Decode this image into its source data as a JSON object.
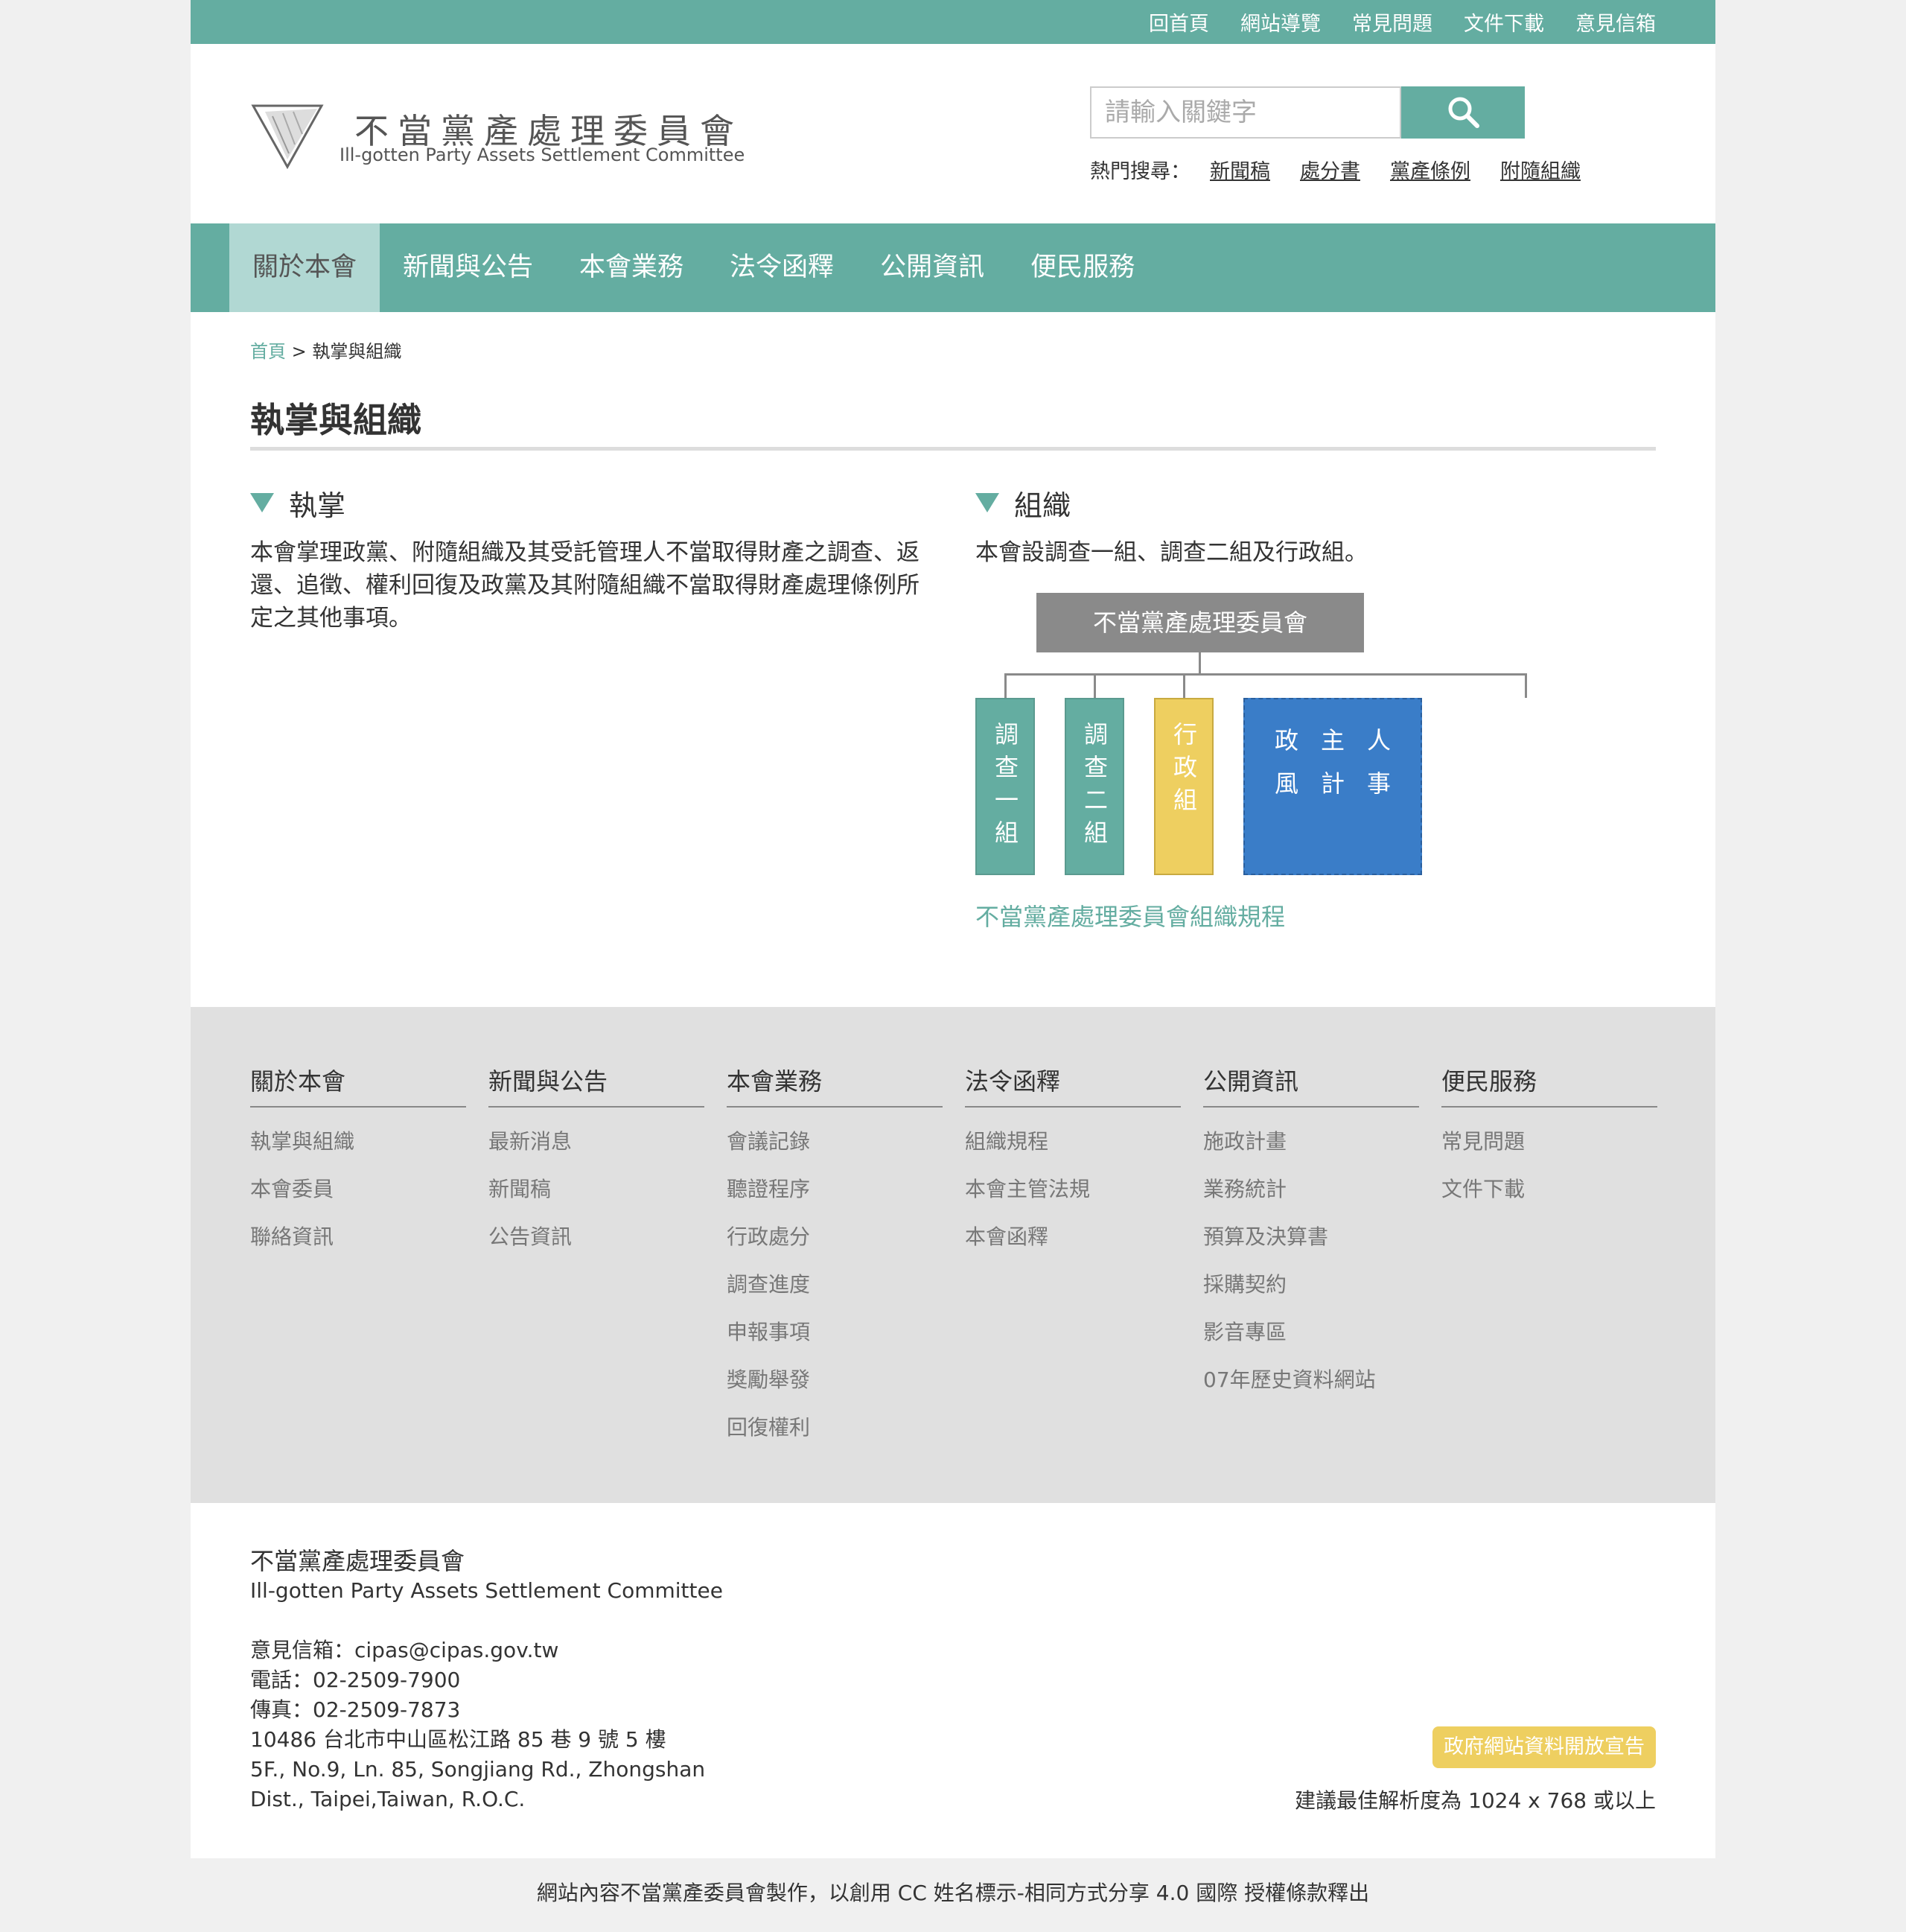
{
  "topbar": {
    "links": [
      "回首頁",
      "網站導覽",
      "常見問題",
      "文件下載",
      "意見信箱"
    ]
  },
  "logo": {
    "zh": "不當黨產處理委員會",
    "en": "Ill-gotten Party Assets Settlement Committee"
  },
  "search": {
    "placeholder": "請輸入關鍵字",
    "hot_label": "熱門搜尋：",
    "hot_links": [
      "新聞稿",
      "處分書",
      "黨產條例",
      "附隨組織"
    ]
  },
  "nav": {
    "items": [
      "關於本會",
      "新聞與公告",
      "本會業務",
      "法令函釋",
      "公開資訊",
      "便民服務"
    ],
    "active_index": 0
  },
  "breadcrumb": {
    "home": "首頁",
    "separator": ">",
    "current": "執掌與組織"
  },
  "page_title": "執掌與組織",
  "duty": {
    "heading": "執掌",
    "text": "本會掌理政黨、附隨組織及其受託管理人不當取得財產之調查、返還、追徵、權利回復及政黨及其附隨組織不當取得財產處理條例所定之其他事項。"
  },
  "organization": {
    "heading": "組織",
    "text": "本會設調查一組、調查二組及行政組。",
    "chart": {
      "top": "不當黨產處理委員會",
      "units": [
        "調查一組",
        "調查二組",
        "行政組"
      ],
      "blue_units": [
        [
          "政",
          "主",
          "人"
        ],
        [
          "風",
          "計",
          "事"
        ]
      ]
    },
    "link": "不當黨產處理委員會組織規程"
  },
  "footer_nav": [
    {
      "title": "關於本會",
      "links": [
        "執掌與組織",
        "本會委員",
        "聯絡資訊"
      ]
    },
    {
      "title": "新聞與公告",
      "links": [
        "最新消息",
        "新聞稿",
        "公告資訊"
      ]
    },
    {
      "title": "本會業務",
      "links": [
        "會議記錄",
        "聽證程序",
        "行政處分",
        "調查進度",
        "申報事項",
        "獎勵舉發",
        "回復權利"
      ]
    },
    {
      "title": "法令函釋",
      "links": [
        "組織規程",
        "本會主管法規",
        "本會函釋"
      ]
    },
    {
      "title": "公開資訊",
      "links": [
        "施政計畫",
        "業務統計",
        "預算及決算書",
        "採購契約",
        "影音專區",
        "07年歷史資料網站"
      ]
    },
    {
      "title": "便民服務",
      "links": [
        "常見問題",
        "文件下載"
      ]
    }
  ],
  "footer_info": {
    "org_zh": "不當黨產處理委員會",
    "org_en": "Ill-gotten Party Assets Settlement Committee",
    "email": "意見信箱：cipas@cipas.gov.tw",
    "phone": "電話：02-2509-7900",
    "fax": "傳真：02-2509-7873",
    "address_zh": "10486 台北市中山區松江路 85 巷 9 號 5 樓",
    "address_en_1": "5F., No.9, Ln. 85, Songjiang Rd., Zhongshan",
    "address_en_2": "Dist., Taipei,Taiwan, R.O.C."
  },
  "open_data_badge": "政府網站資料開放宣告",
  "resolution_note": "建議最佳解析度為 1024 x 768 或以上",
  "license": "網站內容不當黨產委員會製作，以創用 CC 姓名標示-相同方式分享 4.0 國際 授權條款釋出",
  "colors": {
    "primary": "#64ada1",
    "nav_active": "#b1d8d3",
    "yellow": "#eecf60",
    "blue": "#3a7dc8",
    "gray_box": "#8a8a8a"
  }
}
